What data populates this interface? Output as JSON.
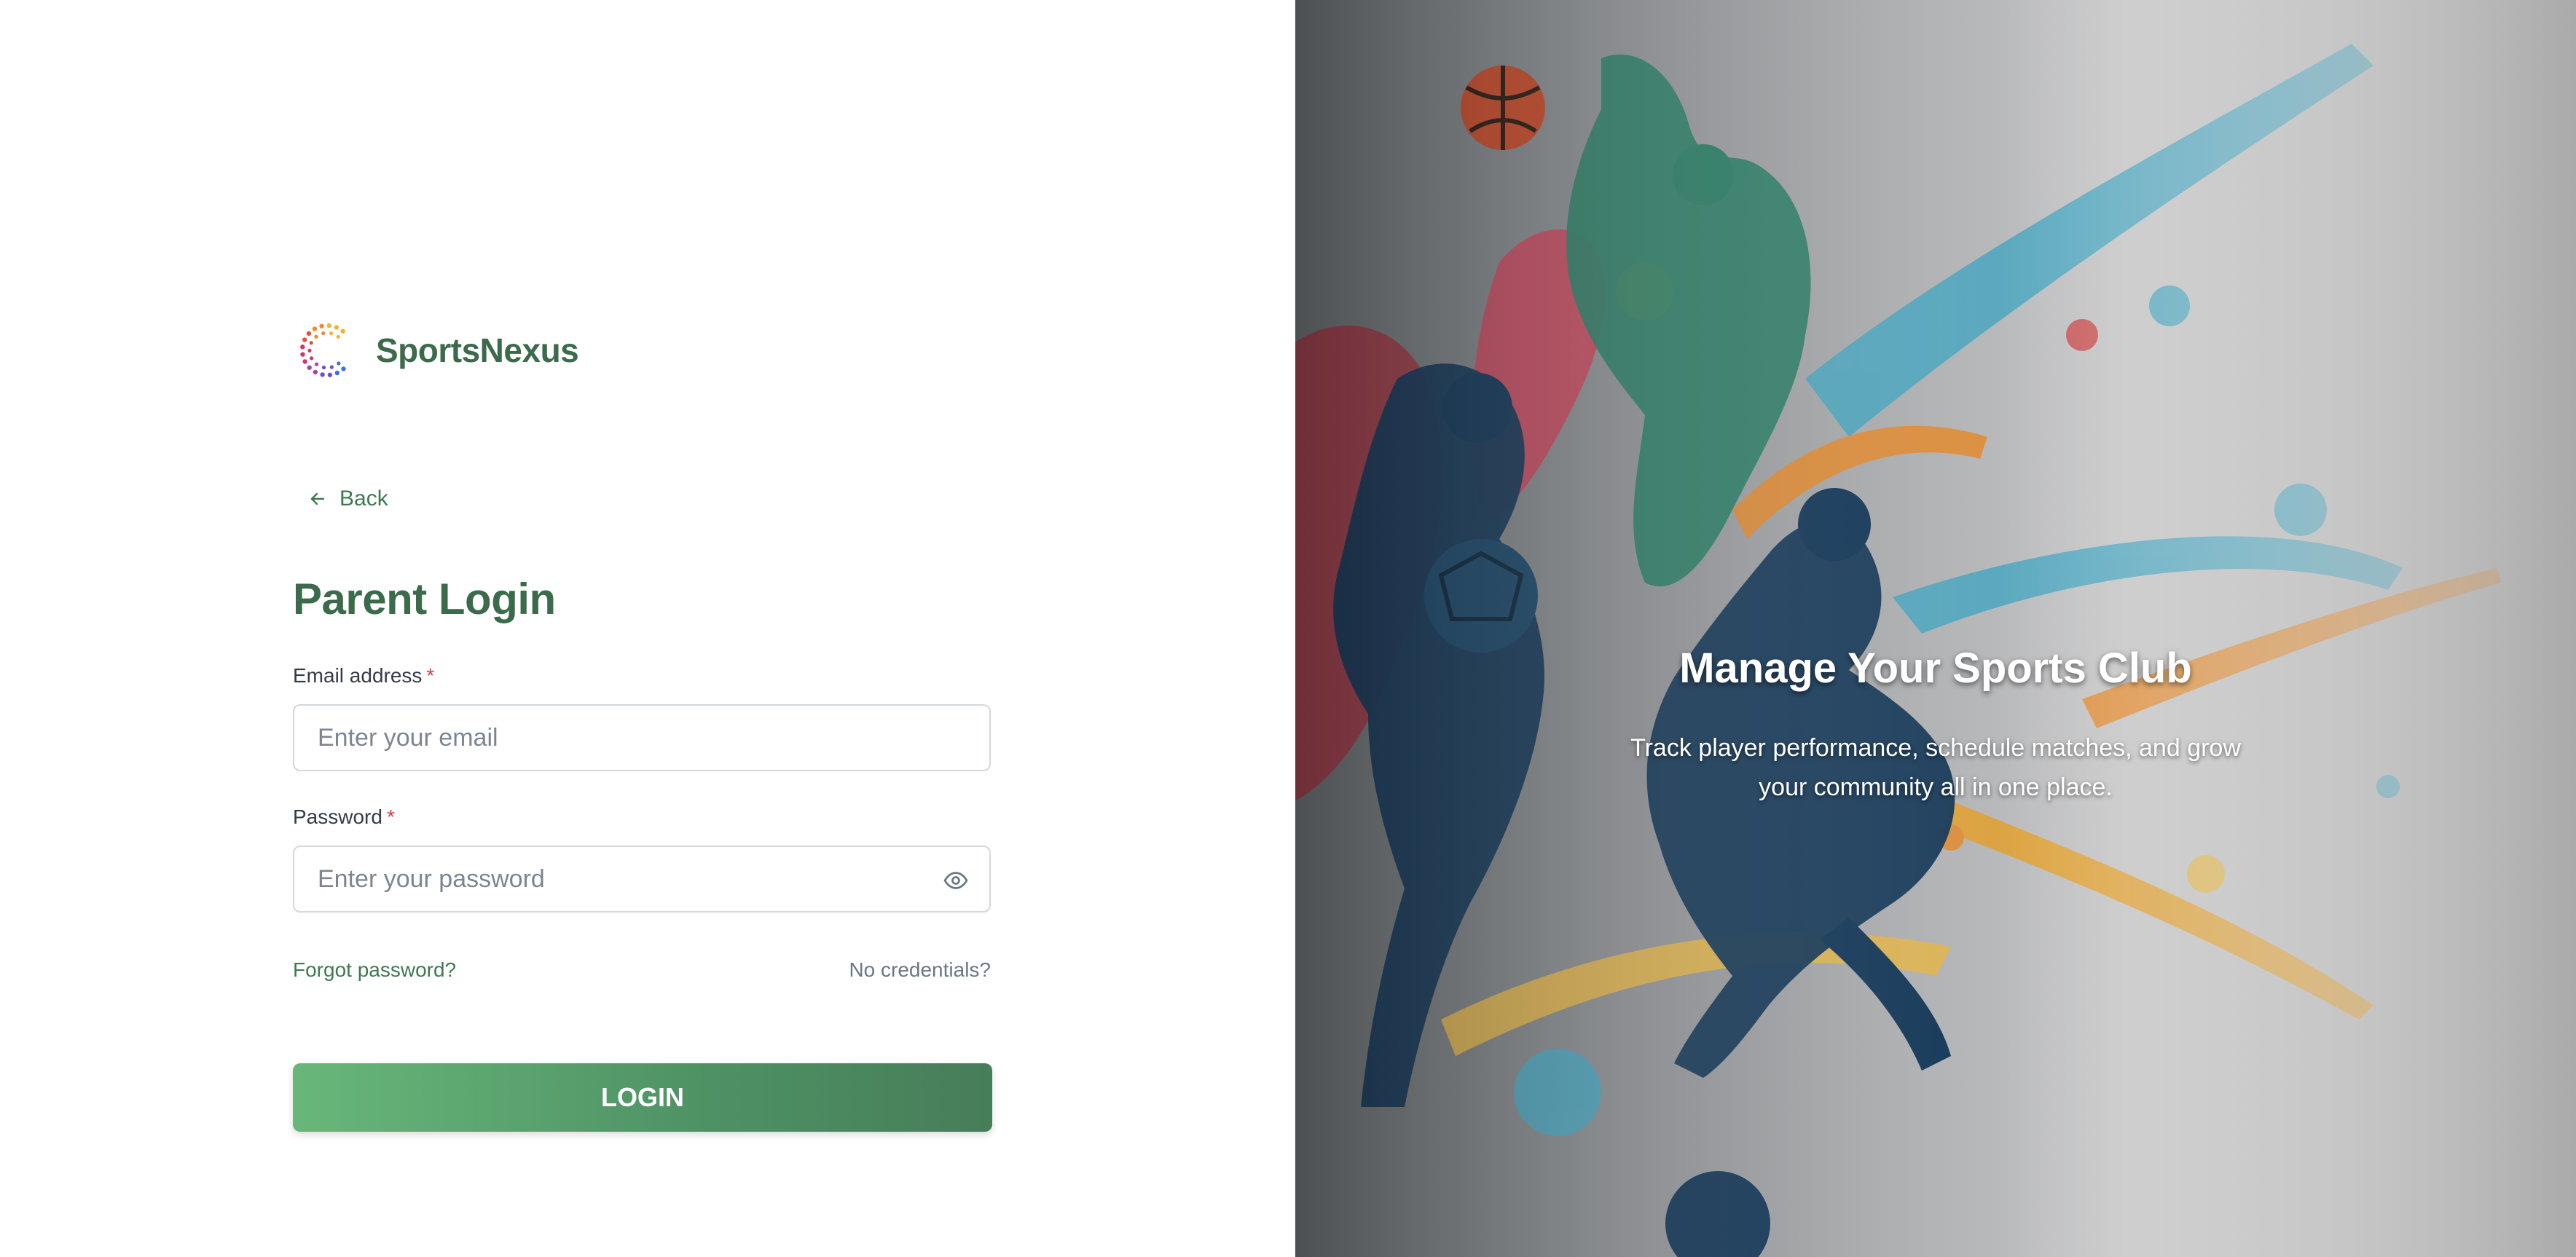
{
  "brand": {
    "name": "SportsNexus"
  },
  "nav": {
    "back_label": "Back"
  },
  "form": {
    "title": "Parent Login",
    "email": {
      "label": "Email address",
      "required_mark": "*",
      "placeholder": "Enter your email",
      "value": ""
    },
    "password": {
      "label": "Password",
      "required_mark": "*",
      "placeholder": "Enter your password",
      "value": ""
    },
    "forgot_label": "Forgot password?",
    "no_credentials_label": "No credentials?",
    "submit_label": "LOGIN"
  },
  "hero": {
    "title": "Manage Your Sports Club",
    "subtitle": "Track player performance, schedule matches, and grow your community all in one place."
  },
  "colors": {
    "brand_green": "#3c6b4b",
    "link_green": "#3d7a52",
    "button_gradient_start": "#68b77a",
    "button_gradient_end": "#477d59",
    "required": "#e0383e"
  },
  "icons": {
    "back": "arrow-left-icon",
    "password_toggle": "eye-icon",
    "logo": "dotted-c-logo"
  }
}
